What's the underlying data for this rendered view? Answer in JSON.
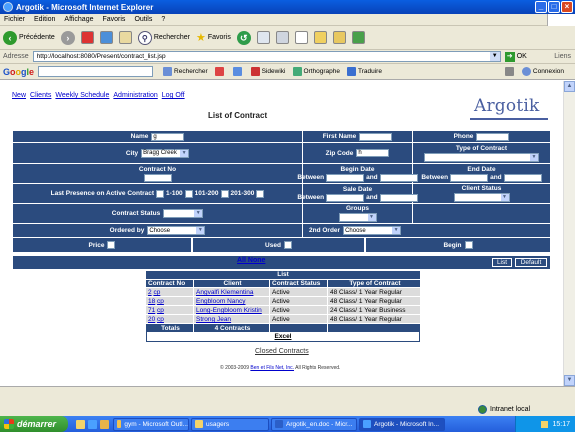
{
  "window": {
    "title": "Argotik - Microsoft Internet Explorer"
  },
  "menu": [
    "Fichier",
    "Edition",
    "Affichage",
    "Favoris",
    "Outils",
    "?"
  ],
  "toolbar": {
    "back": "Précédente",
    "search": "Rechercher",
    "favorites": "Favoris"
  },
  "address": {
    "label": "Adresse",
    "url": "http://localhost:8080/Present/contract_list.jsp",
    "go": "OK",
    "links": "Liens"
  },
  "googlebar": {
    "search": "Rechercher",
    "sidewiki": "Sidewiki",
    "spell": "Orthographe",
    "translate": "Traduire",
    "login": "Connexion"
  },
  "nav": [
    "New",
    "Clients",
    "Weekly Schedule",
    "Administration",
    "Log Off"
  ],
  "brand": "Argotik",
  "page_title": "List of Contract",
  "form": {
    "name_label": "Name",
    "name_value": "g",
    "first_name_label": "First Name",
    "phone_label": "Phone",
    "city_label": "City",
    "city_value": "Bragg Creek",
    "zip_label": "Zip Code",
    "zip_value": "h",
    "type_label": "Type of Contract",
    "contract_no_label": "Contract No",
    "begin_date_label": "Begin Date",
    "end_date_label": "End Date",
    "between": "Between",
    "and": "and",
    "last_presence_label": "Last Presence on Active Contract",
    "range1": "1-100",
    "range2": "101-200",
    "range3": "201-300",
    "sale_date_label": "Sale Date",
    "client_status_label": "Client Status",
    "groups_label": "Groups",
    "contract_status_label": "Contract Status",
    "ordered_by_label": "Ordered by",
    "ordered_by_value": "Choose",
    "order2_label": "2nd Order",
    "order2_value": "Choose",
    "price_label": "Price",
    "used_label": "Used",
    "begin_label": "Begin"
  },
  "actions": {
    "all_none": "All None",
    "list": "List",
    "default": "Default"
  },
  "results": {
    "title": "List",
    "columns": [
      "Contract No",
      "Client",
      "Contract Status",
      "Type of Contract"
    ],
    "rows": [
      {
        "no": "2",
        "cp": "cp",
        "client": "Angvalfi Klementina",
        "status": "Active",
        "type": "48 Class/ 1 Year Regular"
      },
      {
        "no": "18",
        "cp": "cp",
        "client": "Engbloom Nancy",
        "status": "Active",
        "type": "48 Class/ 1 Year Regular"
      },
      {
        "no": "71",
        "cp": "cp",
        "client": "Long-Engbloom Kristin",
        "status": "Active",
        "type": "24 Class/ 1 Year Business"
      },
      {
        "no": "20",
        "cp": "cp",
        "client": "Strong Jean",
        "status": "Active",
        "type": "48 Class/ 1 Year Regular"
      }
    ],
    "totals_label": "Totals",
    "totals_value": "4 Contracts",
    "excel": "Excel"
  },
  "closed_link": "Closed Contracts",
  "copyright_pre": "© 2003-2009",
  "copyright_link": "Ben et Fils Net, Inc.",
  "copyright_post": "All Rights Reserved.",
  "status": {
    "zone": "Intranet local"
  },
  "taskbar": {
    "start": "démarrer",
    "tasks": [
      "gym - Microsoft Outl...",
      "usagers",
      "Argotik_en.doc - Micr...",
      "Argotik - Microsoft In..."
    ],
    "clock": "15:17"
  }
}
